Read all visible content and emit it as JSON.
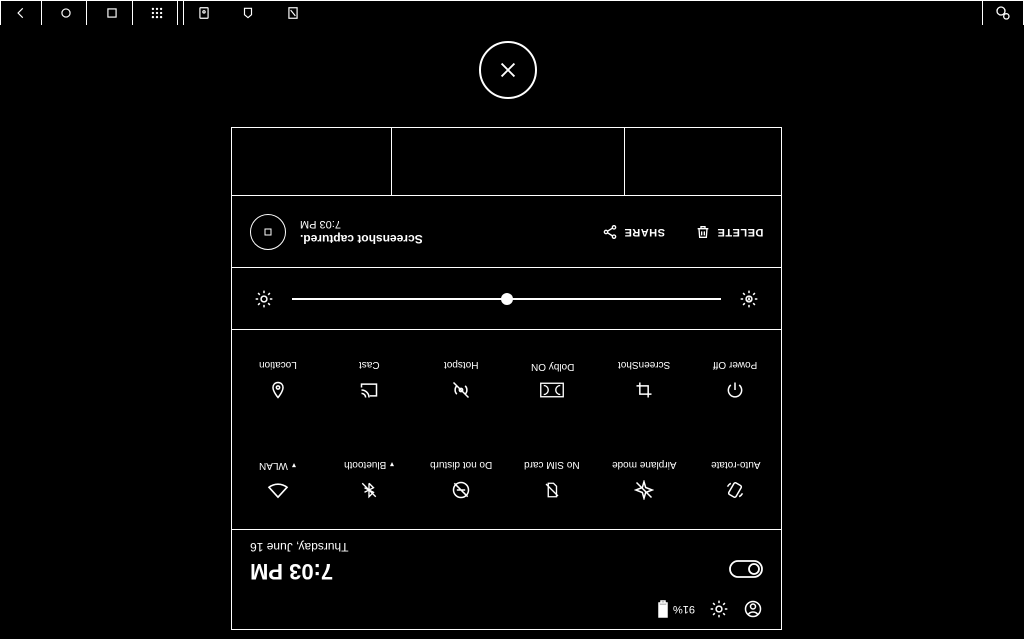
{
  "chrome": {},
  "notification": {
    "time": "7:03 PM",
    "title": "Screenshot captured.",
    "share": "SHARE",
    "delete": "DELETE"
  },
  "tiles": {
    "row2": [
      {
        "label": "Location"
      },
      {
        "label": "Cast"
      },
      {
        "label": "Hotspot"
      },
      {
        "label": "Dolby ON"
      },
      {
        "label": "ScreenShot"
      },
      {
        "label": "Power Off"
      }
    ],
    "row1": [
      {
        "label": "WLAN",
        "caret": true
      },
      {
        "label": "Bluetooth",
        "caret": true
      },
      {
        "label": "Do not disturb"
      },
      {
        "label": "No SIM card"
      },
      {
        "label": "Airplane mode"
      },
      {
        "label": "Auto-rotate"
      }
    ]
  },
  "footer": {
    "date": "Thursday, June 16",
    "time": "7:03 PM",
    "battery": "91%"
  }
}
